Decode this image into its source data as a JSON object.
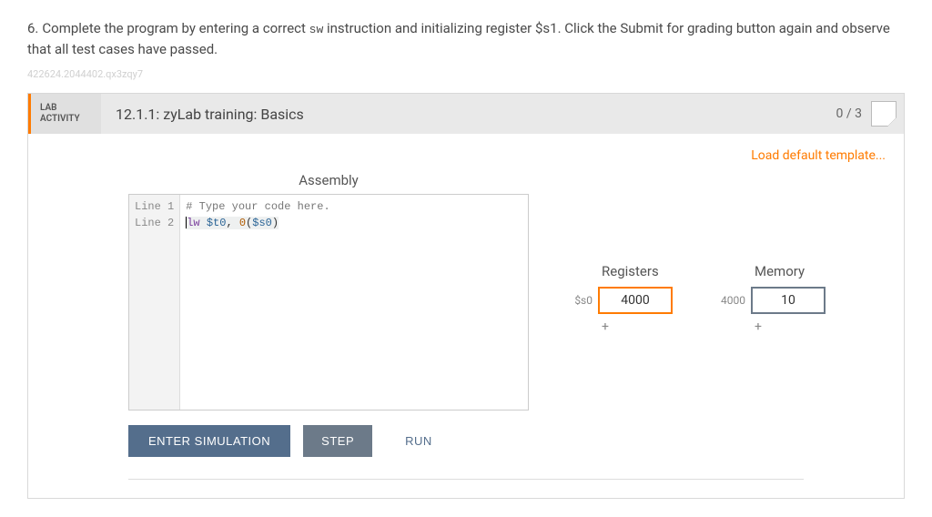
{
  "instruction": {
    "number": "6.",
    "text_before": "Complete the program by entering a correct ",
    "code1": "sw",
    "text_mid": " instruction and initializing register ",
    "reg": "$s1",
    "text_after": ". Click the Submit for grading button again and observe that all test cases have passed."
  },
  "watermark": "422624.2044402.qx3zqy7",
  "lab": {
    "tag_line1": "LAB",
    "tag_line2": "ACTIVITY",
    "title": "12.1.1: zyLab training: Basics",
    "score": "0 / 3"
  },
  "template_link": "Load default template...",
  "assembly_label": "Assembly",
  "code": {
    "gutter": [
      "Line 1",
      "Line 2"
    ],
    "line1_comment": "# Type your code here.",
    "line2_kw": "lw",
    "line2_reg1": "$t0",
    "line2_sep": ", ",
    "line2_num": "0",
    "line2_open": "(",
    "line2_reg2": "$s0",
    "line2_close": ")"
  },
  "buttons": {
    "enter": "ENTER SIMULATION",
    "step": "STEP",
    "run": "RUN"
  },
  "registers": {
    "title": "Registers",
    "rows": [
      {
        "label": "$s0",
        "value": "4000"
      }
    ],
    "add": "+"
  },
  "memory": {
    "title": "Memory",
    "rows": [
      {
        "label": "4000",
        "value": "10"
      }
    ],
    "add": "+"
  }
}
